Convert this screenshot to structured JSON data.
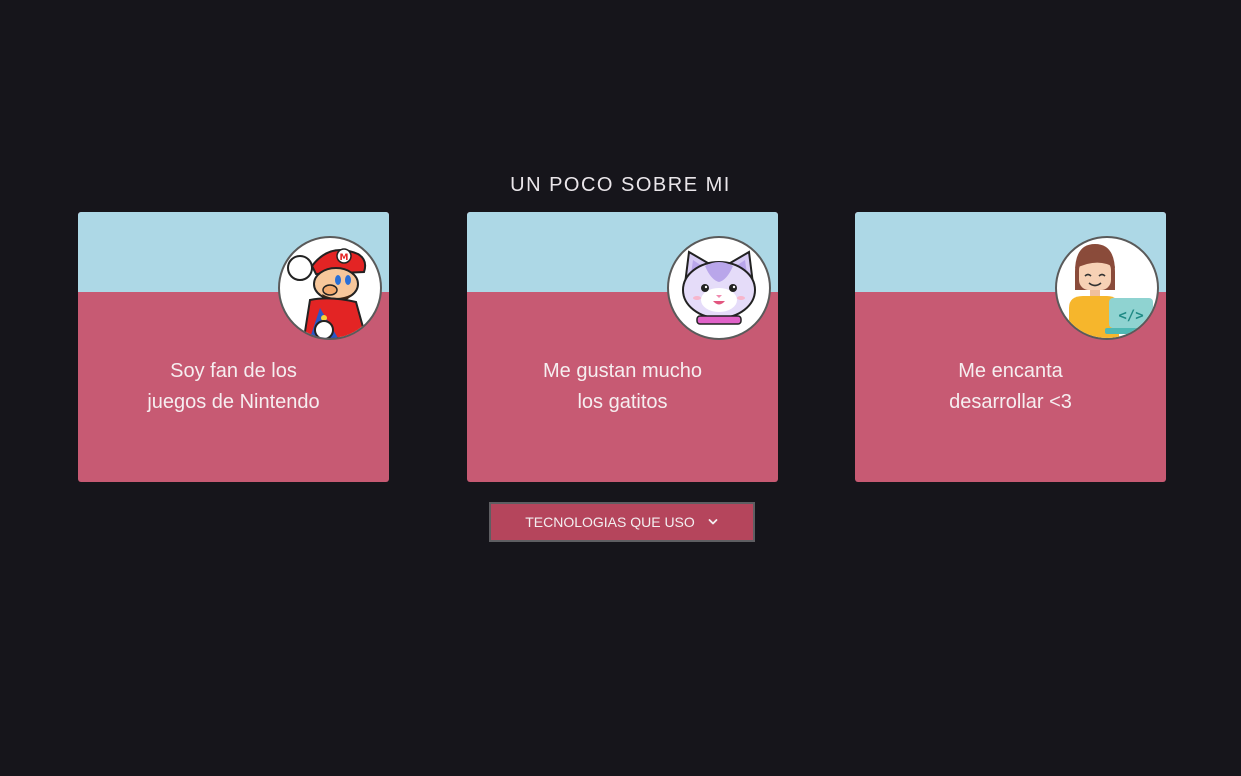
{
  "section": {
    "title": "UN POCO SOBRE MI"
  },
  "cards": [
    {
      "icon": "mario-icon",
      "line1": "Soy fan de los",
      "line2": "juegos de Nintendo"
    },
    {
      "icon": "cat-icon",
      "line1": "Me gustan mucho",
      "line2": "los gatitos"
    },
    {
      "icon": "developer-icon",
      "line1": "Me encanta",
      "line2": "desarrollar <3"
    }
  ],
  "tech_button": {
    "label": "TECNOLOGIAS QUE USO",
    "icon": "chevron-down-icon"
  },
  "colors": {
    "background": "#16151b",
    "card_top": "#add8e6",
    "card_body": "#c75a73",
    "button": "#b5455c"
  }
}
